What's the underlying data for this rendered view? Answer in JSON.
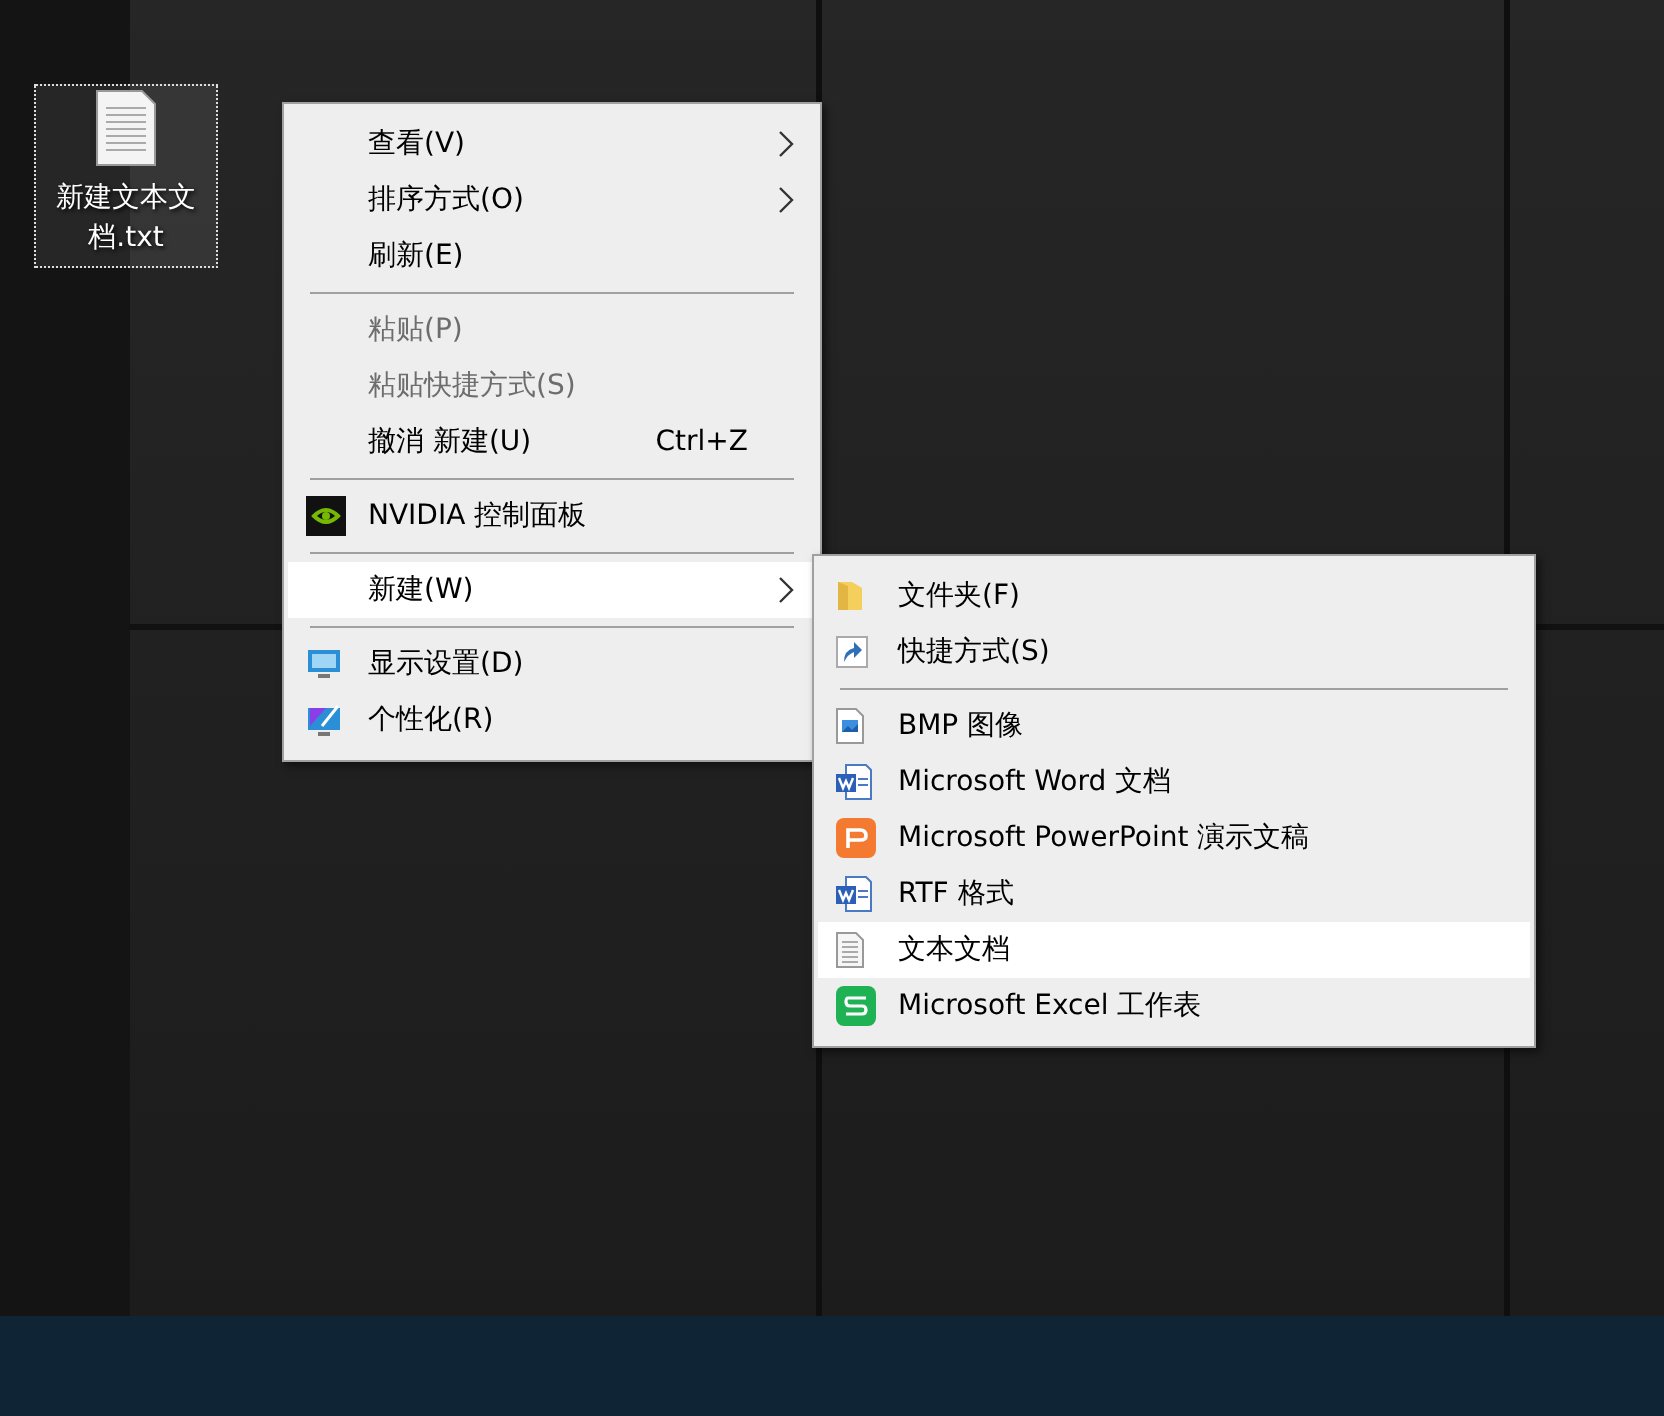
{
  "desktop_icons": [
    {
      "label": "新建文本文档.txt",
      "selected": true
    }
  ],
  "context_menu": {
    "items": [
      {
        "kind": "item",
        "label": "查看(V)",
        "submenu": true,
        "disabled": false,
        "selected": false
      },
      {
        "kind": "item",
        "label": "排序方式(O)",
        "submenu": true,
        "disabled": false,
        "selected": false
      },
      {
        "kind": "item",
        "label": "刷新(E)",
        "submenu": false,
        "disabled": false,
        "selected": false
      },
      {
        "kind": "separator"
      },
      {
        "kind": "item",
        "label": "粘贴(P)",
        "submenu": false,
        "disabled": true,
        "selected": false
      },
      {
        "kind": "item",
        "label": "粘贴快捷方式(S)",
        "submenu": false,
        "disabled": true,
        "selected": false
      },
      {
        "kind": "item",
        "label": "撤消 新建(U)",
        "shortcut": "Ctrl+Z",
        "submenu": false,
        "disabled": false,
        "selected": false
      },
      {
        "kind": "separator"
      },
      {
        "kind": "item",
        "label": "NVIDIA 控制面板",
        "submenu": false,
        "disabled": false,
        "selected": false
      },
      {
        "kind": "separator"
      },
      {
        "kind": "item",
        "label": "新建(W)",
        "submenu": true,
        "disabled": false,
        "selected": true
      },
      {
        "kind": "separator"
      },
      {
        "kind": "item",
        "label": "显示设置(D)",
        "submenu": false,
        "disabled": false,
        "selected": false
      },
      {
        "kind": "item",
        "label": "个性化(R)",
        "submenu": false,
        "disabled": false,
        "selected": false
      }
    ]
  },
  "new_submenu": {
    "items": [
      {
        "kind": "item",
        "label": "文件夹(F)",
        "selected": false
      },
      {
        "kind": "item",
        "label": "快捷方式(S)",
        "selected": false
      },
      {
        "kind": "separator"
      },
      {
        "kind": "item",
        "label": "BMP 图像",
        "selected": false
      },
      {
        "kind": "item",
        "label": "Microsoft Word 文档",
        "selected": false
      },
      {
        "kind": "item",
        "label": "Microsoft PowerPoint 演示文稿",
        "selected": false
      },
      {
        "kind": "item",
        "label": "RTF 格式",
        "selected": false
      },
      {
        "kind": "item",
        "label": "文本文档",
        "selected": true
      },
      {
        "kind": "item",
        "label": "Microsoft Excel 工作表",
        "selected": false
      }
    ]
  }
}
